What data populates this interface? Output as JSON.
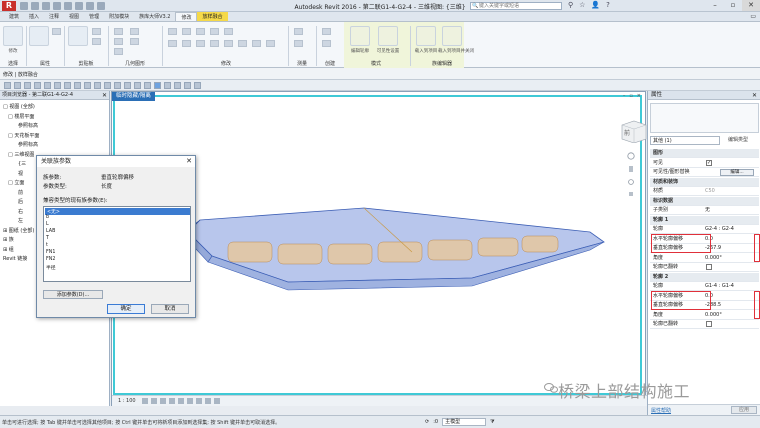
{
  "titlebar": {
    "title": "Autodesk Revit 2016 -    第二联G1-4-G2-4 - 三维视图: {三维}",
    "search_placeholder": "键入关键字或短语"
  },
  "ribbon": {
    "tabs": [
      "建筑",
      "插入",
      "注释",
      "视图",
      "管理",
      "附加模块",
      "族库大师V3.2",
      "修改",
      "放样融合"
    ],
    "active_tab": "修改",
    "context_tab": "放样融合",
    "group_labels": [
      "选择",
      "属性",
      "剪贴板",
      "几何图形",
      "修改",
      "测量",
      "创建",
      "模式",
      "族编辑器"
    ],
    "labels": {
      "modify": "修改",
      "properties": "属性",
      "edit_profile": "编辑轮廓",
      "edit_path": "可见性设置",
      "load_into_project": "载入到项目",
      "load_and_close": "载入到项目并关闭"
    }
  },
  "modify_bar": {
    "text": "修改 | 放样融合"
  },
  "browser": {
    "title": "项目浏览器 - 第二联G1-4-G2-4",
    "items": [
      {
        "label": "□ 视图 (全部)",
        "indent": 0
      },
      {
        "label": "□ 楼层平面",
        "indent": 1
      },
      {
        "label": "参照标高",
        "indent": 3
      },
      {
        "label": "□ 天花板平面",
        "indent": 1
      },
      {
        "label": "参照标高",
        "indent": 3
      },
      {
        "label": "□ 三维视图",
        "indent": 1
      },
      {
        "label": "{三",
        "indent": 3
      },
      {
        "label": "视",
        "indent": 3
      },
      {
        "label": "□ 立面",
        "indent": 1
      },
      {
        "label": "前",
        "indent": 3
      },
      {
        "label": "后",
        "indent": 3
      },
      {
        "label": "右",
        "indent": 3
      },
      {
        "label": "左",
        "indent": 3
      },
      {
        "label": "⊞ 图纸 (全部)",
        "indent": 0
      },
      {
        "label": "⊞ 族",
        "indent": 0
      },
      {
        "label": "⊞ 组",
        "indent": 0
      },
      {
        "label": "Revit 链接",
        "indent": 0
      }
    ]
  },
  "viewport": {
    "tab_label": "临时隐藏/隔离",
    "scale": "1 : 100",
    "viewcube_label": "前"
  },
  "dialog": {
    "title": "关联族参数",
    "rows": [
      {
        "key": "族参数:",
        "value": "垂直轮廓偏移"
      },
      {
        "key": "参数类型:",
        "value": "长度"
      }
    ],
    "list_label": "兼容类型的现有族参数(E):",
    "list_items": [
      "<无>",
      "b",
      "L",
      "LAB",
      "T",
      "t",
      "FN1",
      "FN2",
      "半径"
    ],
    "selected_index": 0,
    "add_button": "添加参数(D)...",
    "ok_button": "确定",
    "cancel_button": "取消"
  },
  "properties": {
    "title": "属性",
    "type_selector": "其他 (1)",
    "edit_type": "编辑类型",
    "rows": [
      {
        "type": "cat",
        "key": "图形"
      },
      {
        "type": "check",
        "key": "可见",
        "checked": true
      },
      {
        "type": "button",
        "key": "可见性/图形替换",
        "button": "编辑..."
      },
      {
        "type": "cat",
        "key": "材质和装饰"
      },
      {
        "type": "kv",
        "key": "材质",
        "value": "C50",
        "dim": true
      },
      {
        "type": "cat",
        "key": "标识数据"
      },
      {
        "type": "kv",
        "key": "子类别",
        "value": "无"
      },
      {
        "type": "cat",
        "key": "轮廓 1"
      },
      {
        "type": "kv",
        "key": "轮廓",
        "value": "G2-4 : G2-4"
      },
      {
        "type": "kv",
        "key": "水平轮廓偏移",
        "value": "0.0"
      },
      {
        "type": "kv",
        "key": "垂直轮廓偏移",
        "value": "-267.9"
      },
      {
        "type": "kv",
        "key": "角度",
        "value": "0.000°"
      },
      {
        "type": "check",
        "key": "轮廓已翻转",
        "checked": false
      },
      {
        "type": "cat",
        "key": "轮廓 2"
      },
      {
        "type": "kv",
        "key": "轮廓",
        "value": "G1-4 : G1-4"
      },
      {
        "type": "kv",
        "key": "水平轮廓偏移",
        "value": "0.0"
      },
      {
        "type": "kv",
        "key": "垂直轮廓偏移",
        "value": "-288.5"
      },
      {
        "type": "kv",
        "key": "角度",
        "value": "0.000°"
      },
      {
        "type": "check",
        "key": "轮廓已翻转",
        "checked": false
      }
    ],
    "help_link": "属性帮助",
    "apply_button": "应用"
  },
  "statusbar": {
    "text": "单击可进行选择; 按 Tab 键并单击可选择其他项目; 按 Ctrl 键并单击可将新项目添加到选择集; 按 Shift 键并单击可取消选择。",
    "zero": ":0",
    "model": "主模型"
  },
  "watermark": {
    "text": "桥梁上部结构施工"
  },
  "colors": {
    "accent": "#2b6fb6",
    "context_tab": "#f5d949",
    "highlight_frame": "#3fc9d6",
    "annotation_red": "#e0303a",
    "solid_blue": "#6f8fd6",
    "void_orange": "#e9c79a"
  }
}
